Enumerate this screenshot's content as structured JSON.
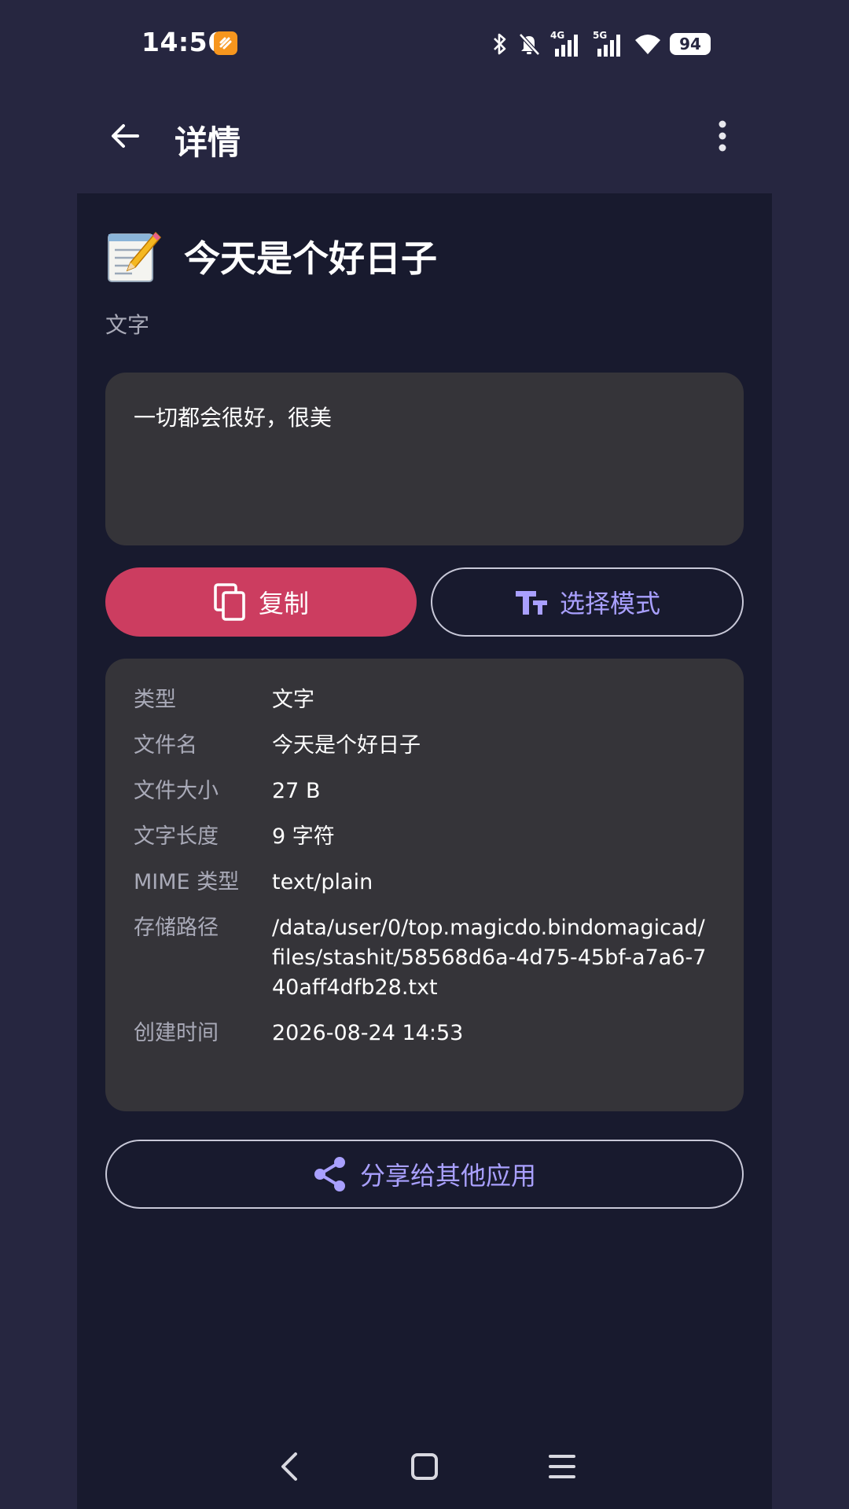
{
  "status_bar": {
    "time": "14:56",
    "battery": "94",
    "network_4g": "4G",
    "network_5g": "5G"
  },
  "app_bar": {
    "title": "详情"
  },
  "item": {
    "title": "今天是个好日子",
    "subtitle": "文字",
    "content": "一切都会很好，很美"
  },
  "actions": {
    "copy_label": "复制",
    "select_mode_label": "选择模式",
    "share_label": "分享给其他应用"
  },
  "info": [
    {
      "label": "类型",
      "value": "文字"
    },
    {
      "label": "文件名",
      "value": "今天是个好日子"
    },
    {
      "label": "文件大小",
      "value": "27 B"
    },
    {
      "label": "文字长度",
      "value": "9 字符"
    },
    {
      "label": "MIME 类型",
      "value": "text/plain"
    },
    {
      "label": "存储路径",
      "value": "/data/user/0/top.magicdo.bindomagicad/files/stashit/58568d6a-4d75-45bf-a7a6-740aff4dfb28.txt"
    },
    {
      "label": "创建时间",
      "value": "2026-08-24 14:53"
    }
  ],
  "colors": {
    "background": "#262640",
    "panel": "#181a2e",
    "card": "#353439",
    "accent_primary": "#cc3d60",
    "accent_text": "#a9a0ff"
  }
}
